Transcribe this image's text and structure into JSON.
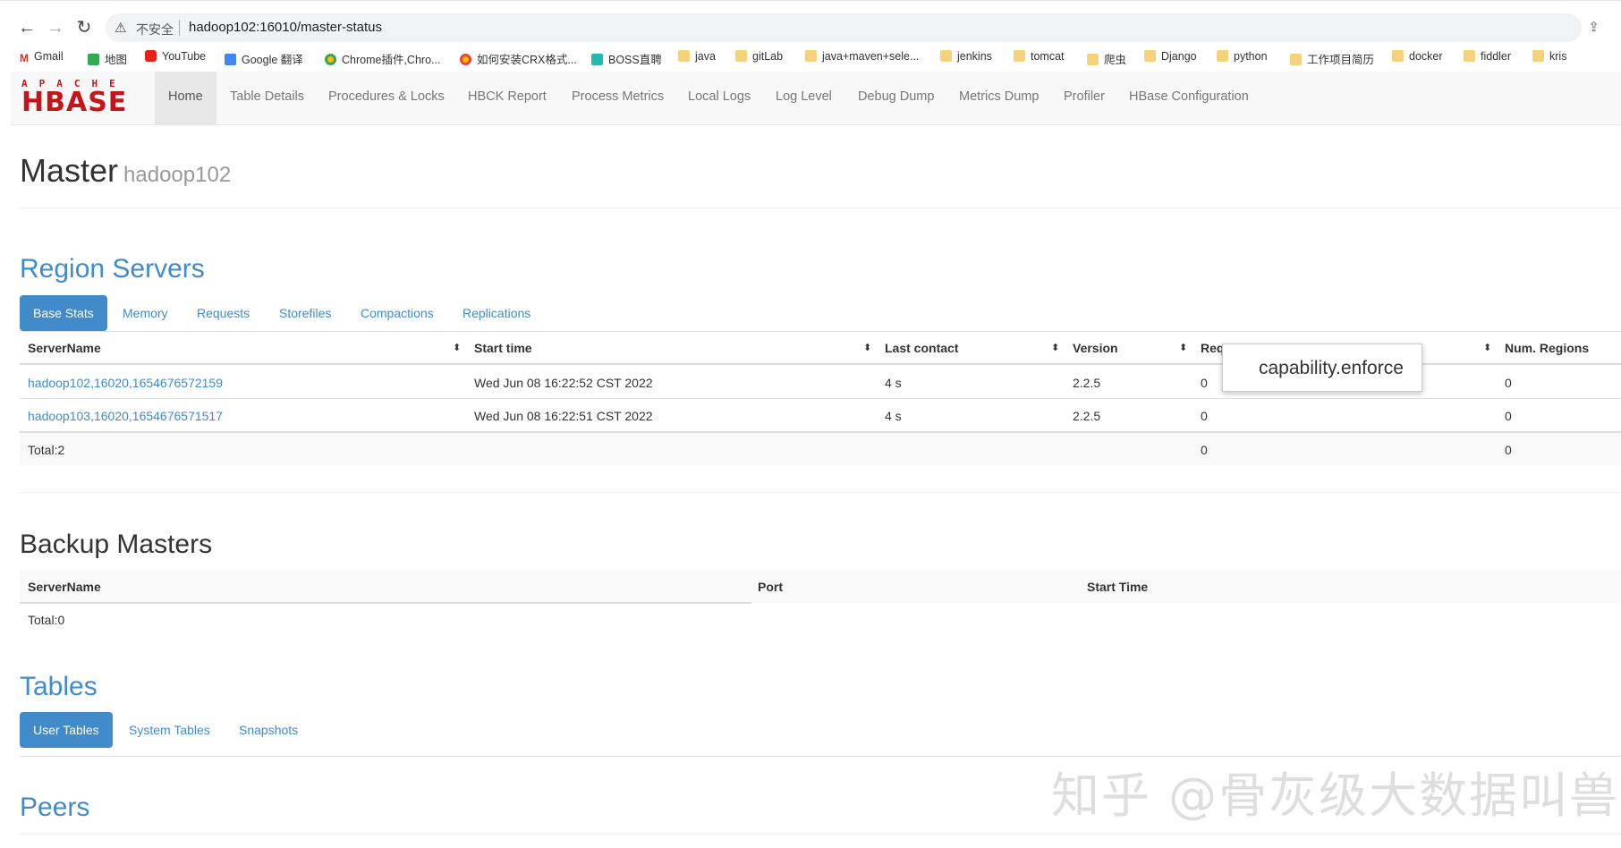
{
  "browser": {
    "security_label": "不安全",
    "url": "hadoop102:16010/master-status"
  },
  "bookmarks": [
    {
      "label": "Gmail",
      "icon": "gmail-icon"
    },
    {
      "label": "地图",
      "icon": "maps-icon"
    },
    {
      "label": "YouTube",
      "icon": "youtube-icon"
    },
    {
      "label": "Google 翻译",
      "icon": "translate-icon"
    },
    {
      "label": "Chrome插件,Chro...",
      "icon": "chrome-icon"
    },
    {
      "label": "如何安装CRX格式...",
      "icon": "chrome-icon"
    },
    {
      "label": "BOSS直聘",
      "icon": "boss-icon"
    },
    {
      "label": "java",
      "icon": "folder-icon"
    },
    {
      "label": "gitLab",
      "icon": "folder-icon"
    },
    {
      "label": "java+maven+sele...",
      "icon": "folder-icon"
    },
    {
      "label": "jenkins",
      "icon": "folder-icon"
    },
    {
      "label": "tomcat",
      "icon": "folder-icon"
    },
    {
      "label": "爬虫",
      "icon": "folder-icon"
    },
    {
      "label": "Django",
      "icon": "folder-icon"
    },
    {
      "label": "python",
      "icon": "folder-icon"
    },
    {
      "label": "工作项目简历",
      "icon": "folder-icon"
    },
    {
      "label": "docker",
      "icon": "folder-icon"
    },
    {
      "label": "fiddler",
      "icon": "folder-icon"
    },
    {
      "label": "kris",
      "icon": "folder-icon"
    }
  ],
  "logo": {
    "apache": "APACHE",
    "hbase": "HBASE"
  },
  "menu": [
    "Home",
    "Table Details",
    "Procedures & Locks",
    "HBCK Report",
    "Process Metrics",
    "Local Logs",
    "Log Level",
    "Debug Dump",
    "Metrics Dump",
    "Profiler",
    "HBase Configuration"
  ],
  "header": {
    "title": "Master",
    "host": "hadoop102"
  },
  "region_servers": {
    "title": "Region Servers",
    "tabs": [
      "Base Stats",
      "Memory",
      "Requests",
      "Storefiles",
      "Compactions",
      "Replications"
    ],
    "columns": [
      "ServerName",
      "Start time",
      "Last contact",
      "Version",
      "Req",
      "Num. Regions"
    ],
    "rows": [
      {
        "server": "hadoop102,16020,1654676572159",
        "start": "Wed Jun 08 16:22:52 CST 2022",
        "contact": "4 s",
        "version": "2.2.5",
        "req": "0",
        "regions": "0"
      },
      {
        "server": "hadoop103,16020,1654676571517",
        "start": "Wed Jun 08 16:22:51 CST 2022",
        "contact": "4 s",
        "version": "2.2.5",
        "req": "0",
        "regions": "0"
      }
    ],
    "total": {
      "label": "Total:2",
      "req": "0",
      "regions": "0"
    }
  },
  "tooltip": "capability.enforce",
  "backup_masters": {
    "title": "Backup Masters",
    "columns": [
      "ServerName",
      "Port",
      "Start Time"
    ],
    "total": "Total:0"
  },
  "tables": {
    "title": "Tables",
    "tabs": [
      "User Tables",
      "System Tables",
      "Snapshots"
    ]
  },
  "peers": {
    "title": "Peers"
  },
  "watermark": "知乎 @骨灰级大数据叫兽"
}
